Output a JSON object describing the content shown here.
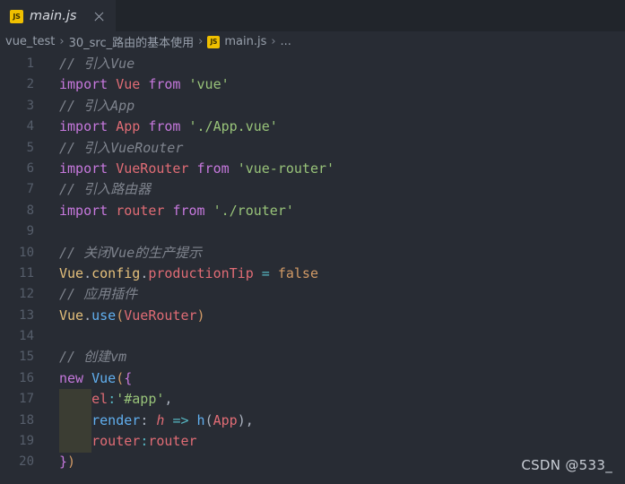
{
  "window": {
    "background_color": "#282c34",
    "tabbar_color": "#21252b"
  },
  "tabbar": {
    "tabs": [
      {
        "icon": "js-file-icon",
        "icon_label": "JS",
        "label": "main.js",
        "preview_italic": true,
        "active": true,
        "close_label": "close-tab"
      }
    ]
  },
  "breadcrumb": {
    "items": [
      {
        "label": "vue_test",
        "icon": null
      },
      {
        "label": "30_src_路由的基本使用",
        "icon": null
      },
      {
        "label": "main.js",
        "icon": "js-file-icon",
        "icon_label": "JS"
      },
      {
        "label": "...",
        "icon": null
      }
    ],
    "separator": "›"
  },
  "editor": {
    "language": "javascript",
    "theme": "One Dark Pro",
    "indent_guide_color": "#3b3d33",
    "line_number_color": "#565e6b",
    "lines": [
      {
        "n": "1",
        "tokens": [
          {
            "t": "// 引入Vue",
            "c": "t-comment"
          }
        ]
      },
      {
        "n": "2",
        "tokens": [
          {
            "t": "import",
            "c": "t-kw"
          },
          {
            "t": " ",
            "c": "t-punc"
          },
          {
            "t": "Vue",
            "c": "t-var"
          },
          {
            "t": " ",
            "c": "t-punc"
          },
          {
            "t": "from",
            "c": "t-kw"
          },
          {
            "t": " ",
            "c": "t-punc"
          },
          {
            "t": "'vue'",
            "c": "t-str"
          }
        ]
      },
      {
        "n": "3",
        "tokens": [
          {
            "t": "// 引入App",
            "c": "t-comment"
          }
        ]
      },
      {
        "n": "4",
        "tokens": [
          {
            "t": "import",
            "c": "t-kw"
          },
          {
            "t": " ",
            "c": "t-punc"
          },
          {
            "t": "App",
            "c": "t-var"
          },
          {
            "t": " ",
            "c": "t-punc"
          },
          {
            "t": "from",
            "c": "t-kw"
          },
          {
            "t": " ",
            "c": "t-punc"
          },
          {
            "t": "'./App.vue'",
            "c": "t-str"
          }
        ]
      },
      {
        "n": "5",
        "tokens": [
          {
            "t": "// 引入VueRouter",
            "c": "t-comment"
          }
        ]
      },
      {
        "n": "6",
        "tokens": [
          {
            "t": "import",
            "c": "t-kw"
          },
          {
            "t": " ",
            "c": "t-punc"
          },
          {
            "t": "VueRouter",
            "c": "t-var"
          },
          {
            "t": " ",
            "c": "t-punc"
          },
          {
            "t": "from",
            "c": "t-kw"
          },
          {
            "t": " ",
            "c": "t-punc"
          },
          {
            "t": "'vue-router'",
            "c": "t-str"
          }
        ]
      },
      {
        "n": "7",
        "tokens": [
          {
            "t": "// 引入路由器",
            "c": "t-comment"
          }
        ]
      },
      {
        "n": "8",
        "tokens": [
          {
            "t": "import",
            "c": "t-kw"
          },
          {
            "t": " ",
            "c": "t-punc"
          },
          {
            "t": "router",
            "c": "t-var"
          },
          {
            "t": " ",
            "c": "t-punc"
          },
          {
            "t": "from",
            "c": "t-kw"
          },
          {
            "t": " ",
            "c": "t-punc"
          },
          {
            "t": "'./router'",
            "c": "t-str"
          }
        ]
      },
      {
        "n": "9",
        "tokens": []
      },
      {
        "n": "10",
        "tokens": [
          {
            "t": "// 关闭Vue的生产提示",
            "c": "t-comment"
          }
        ]
      },
      {
        "n": "11",
        "tokens": [
          {
            "t": "Vue",
            "c": "t-class"
          },
          {
            "t": ".",
            "c": "t-punc"
          },
          {
            "t": "config",
            "c": "t-class"
          },
          {
            "t": ".",
            "c": "t-punc"
          },
          {
            "t": "productionTip",
            "c": "t-var"
          },
          {
            "t": " ",
            "c": "t-punc"
          },
          {
            "t": "=",
            "c": "t-op"
          },
          {
            "t": " ",
            "c": "t-punc"
          },
          {
            "t": "false",
            "c": "t-num"
          }
        ]
      },
      {
        "n": "12",
        "tokens": [
          {
            "t": "// 应用插件",
            "c": "t-comment"
          }
        ]
      },
      {
        "n": "13",
        "tokens": [
          {
            "t": "Vue",
            "c": "t-class"
          },
          {
            "t": ".",
            "c": "t-punc"
          },
          {
            "t": "use",
            "c": "t-fn"
          },
          {
            "t": "(",
            "c": "t-br1"
          },
          {
            "t": "VueRouter",
            "c": "t-var"
          },
          {
            "t": ")",
            "c": "t-br1"
          }
        ]
      },
      {
        "n": "14",
        "tokens": []
      },
      {
        "n": "15",
        "tokens": [
          {
            "t": "// 创建vm",
            "c": "t-comment"
          }
        ]
      },
      {
        "n": "16",
        "tokens": [
          {
            "t": "new",
            "c": "t-kw"
          },
          {
            "t": " ",
            "c": "t-punc"
          },
          {
            "t": "Vue",
            "c": "t-fn"
          },
          {
            "t": "(",
            "c": "t-br1"
          },
          {
            "t": "{",
            "c": "t-br2"
          }
        ]
      },
      {
        "n": "17",
        "tokens": [
          {
            "t": "    ",
            "c": "t-punc"
          },
          {
            "t": "el",
            "c": "t-var"
          },
          {
            "t": ":",
            "c": "t-op"
          },
          {
            "t": "'#app'",
            "c": "t-str"
          },
          {
            "t": ",",
            "c": "t-punc"
          }
        ]
      },
      {
        "n": "18",
        "tokens": [
          {
            "t": "    ",
            "c": "t-punc"
          },
          {
            "t": "render",
            "c": "t-fn"
          },
          {
            "t": ": ",
            "c": "t-punc"
          },
          {
            "t": "h",
            "c": "t-param"
          },
          {
            "t": " ",
            "c": "t-punc"
          },
          {
            "t": "=>",
            "c": "t-op"
          },
          {
            "t": " ",
            "c": "t-punc"
          },
          {
            "t": "h",
            "c": "t-fn"
          },
          {
            "t": "(",
            "c": "t-punc"
          },
          {
            "t": "App",
            "c": "t-var"
          },
          {
            "t": ")",
            "c": "t-punc"
          },
          {
            "t": ",",
            "c": "t-punc"
          }
        ]
      },
      {
        "n": "19",
        "tokens": [
          {
            "t": "    ",
            "c": "t-punc"
          },
          {
            "t": "router",
            "c": "t-var"
          },
          {
            "t": ":",
            "c": "t-op"
          },
          {
            "t": "router",
            "c": "t-var"
          }
        ]
      },
      {
        "n": "20",
        "tokens": [
          {
            "t": "}",
            "c": "t-br2"
          },
          {
            "t": ")",
            "c": "t-br1"
          }
        ]
      }
    ]
  },
  "watermark": {
    "text": "CSDN @533_"
  }
}
